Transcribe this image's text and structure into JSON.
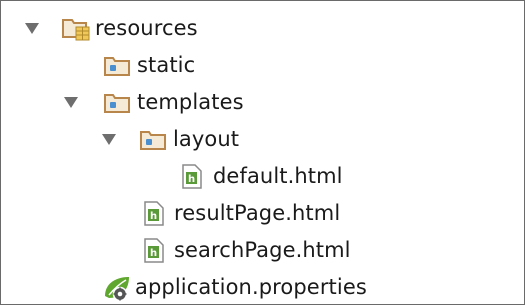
{
  "tree": {
    "resources": {
      "label": "resources",
      "expanded": true,
      "icon": "resources-folder-icon"
    },
    "static": {
      "label": "static",
      "icon": "folder-icon"
    },
    "templates": {
      "label": "templates",
      "expanded": true,
      "icon": "folder-icon"
    },
    "layout": {
      "label": "layout",
      "expanded": true,
      "icon": "folder-icon"
    },
    "default_html": {
      "label": "default.html",
      "icon": "html-file-icon"
    },
    "resultPage_html": {
      "label": "resultPage.html",
      "icon": "html-file-icon"
    },
    "searchPage_html": {
      "label": "searchPage.html",
      "icon": "html-file-icon"
    },
    "application_properties": {
      "label": "application.properties",
      "icon": "spring-leaf-icon"
    }
  },
  "colors": {
    "folder_outline": "#b8864a",
    "folder_fill": "#f5ead5",
    "folder_dot": "#4a90d0",
    "html_file_green": "#5a9a38",
    "spring_green": "#5fa72e",
    "arrow_gray": "#6e6e6e"
  }
}
